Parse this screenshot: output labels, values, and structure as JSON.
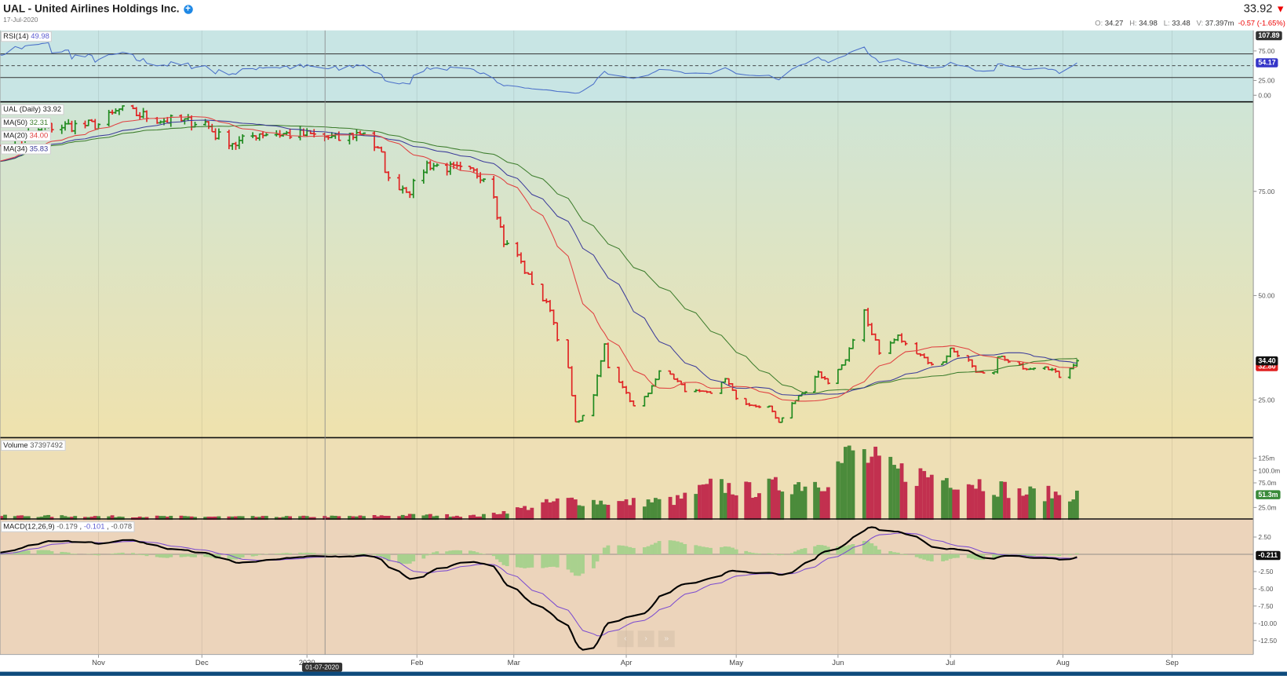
{
  "header": {
    "title": "UAL - United Airlines Holdings Inc.",
    "date": "17-Jul-2020",
    "last_price": "33.92",
    "arrow": "▼",
    "o_label": "O:",
    "o": "34.27",
    "h_label": "H:",
    "h": "34.98",
    "l_label": "L:",
    "l": "33.48",
    "v_label": "V:",
    "v": "37.397m",
    "change": "-0.57 (-1.65%)"
  },
  "legends": {
    "rsi_label": "RSI(14)",
    "rsi_value": "49.98",
    "price_label": "UAL (Daily)",
    "price_value": "33.92",
    "ma50_label": "MA(50)",
    "ma50_value": "32.31",
    "ma20_label": "MA(20)",
    "ma20_value": "34.00",
    "ma34_label": "MA(34)",
    "ma34_value": "35.83",
    "volume_label": "Volume",
    "volume_value": "37397492",
    "macd_label": "MACD(12,26,9)",
    "macd_v1": "-0.179",
    "macd_sep": ",",
    "macd_v2": "-0.101",
    "macd_v3": "-0.078"
  },
  "markers": {
    "rsi_max": "107.89",
    "rsi_last": "54.17",
    "price_last": "34.40",
    "price_ma": "32.80",
    "volume_last": "51.3m",
    "macd_last": "-0.211"
  },
  "crosshair_date": "01-07-2020",
  "nav": {
    "prev": "‹",
    "next": "›",
    "end": "»"
  },
  "colors": {
    "up": "#1f8a1f",
    "down": "#e02424",
    "vol_up": "#4b8b3b",
    "vol_down": "#c2304f",
    "ma20": "#e04040",
    "ma34": "#3b3b9a",
    "ma50": "#3d7d2d",
    "rsi": "#4a6fc9",
    "macd": "#000000",
    "signal": "#7b4bd0",
    "hist": "#a9d18e",
    "tag_rsi": "#3535c8",
    "tag_vol": "#3a8a3a"
  },
  "x_axis": {
    "ticks": [
      "Nov",
      "Dec",
      "2020",
      "Feb",
      "Mar",
      "Apr",
      "May",
      "Jun",
      "Jul",
      "Aug",
      "Sep"
    ]
  },
  "chart_data": [
    {
      "type": "ohlc",
      "panel": "price",
      "yticks": [
        "75.00",
        "50.00",
        "25.00"
      ],
      "ytick_values": [
        75,
        50,
        25
      ],
      "closes": [
        [
          "2019-10-01",
          84.5
        ],
        [
          "2019-10-16",
          90.4
        ],
        [
          "2019-11-01",
          91
        ],
        [
          "2019-11-07",
          94.5
        ],
        [
          "2019-11-20",
          92
        ],
        [
          "2019-12-02",
          91.5
        ],
        [
          "2019-12-05",
          88.5
        ],
        [
          "2019-12-11",
          86.4
        ],
        [
          "2019-12-18",
          89
        ],
        [
          "2020-01-02",
          88.5
        ],
        [
          "2020-01-10",
          87.5
        ],
        [
          "2020-01-17",
          89.4
        ],
        [
          "2020-01-22",
          83.5
        ],
        [
          "2020-01-24",
          77.5
        ],
        [
          "2020-01-30",
          75.2
        ],
        [
          "2020-02-04",
          81.5
        ],
        [
          "2020-02-11",
          80.5
        ],
        [
          "2020-02-18",
          79.5
        ],
        [
          "2020-02-21",
          78.5
        ],
        [
          "2020-02-24",
          74.6
        ],
        [
          "2020-02-25",
          69.7
        ],
        [
          "2020-02-27",
          62.8
        ],
        [
          "2020-03-02",
          59.8
        ],
        [
          "2020-03-04",
          55.9
        ],
        [
          "2020-03-09",
          49
        ],
        [
          "2020-03-11",
          47
        ],
        [
          "2020-03-13",
          40
        ],
        [
          "2020-03-16",
          32.3
        ],
        [
          "2020-03-18",
          19.5
        ],
        [
          "2020-03-20",
          21
        ],
        [
          "2020-03-23",
          26.4
        ],
        [
          "2020-03-26",
          38.2
        ],
        [
          "2020-03-27",
          33
        ],
        [
          "2020-03-31",
          28.3
        ],
        [
          "2020-04-03",
          23.4
        ],
        [
          "2020-04-07",
          26.4
        ],
        [
          "2020-04-10",
          32.3
        ],
        [
          "2020-04-14",
          30.3
        ],
        [
          "2020-04-17",
          27.4
        ],
        [
          "2020-04-24",
          26.4
        ],
        [
          "2020-04-28",
          30.3
        ],
        [
          "2020-05-01",
          25.4
        ],
        [
          "2020-05-06",
          23.4
        ],
        [
          "2020-05-11",
          23.4
        ],
        [
          "2020-05-14",
          19.5
        ],
        [
          "2020-05-18",
          24.4
        ],
        [
          "2020-05-22",
          26.8
        ],
        [
          "2020-05-26",
          31.3
        ],
        [
          "2020-05-29",
          29.3
        ],
        [
          "2020-06-03",
          34.3
        ],
        [
          "2020-06-08",
          47
        ],
        [
          "2020-06-09",
          43.1
        ],
        [
          "2020-06-11",
          39.2
        ],
        [
          "2020-06-12",
          36.2
        ],
        [
          "2020-06-17",
          40.2
        ],
        [
          "2020-06-19",
          38.2
        ],
        [
          "2020-06-23",
          36
        ],
        [
          "2020-06-26",
          33.3
        ],
        [
          "2020-06-29",
          34.3
        ],
        [
          "2020-07-01",
          37.2
        ],
        [
          "2020-07-06",
          34.3
        ],
        [
          "2020-07-08",
          31.3
        ],
        [
          "2020-07-13",
          31.3
        ],
        [
          "2020-07-14",
          35.8
        ],
        [
          "2020-07-17",
          33.9
        ],
        [
          "2020-07-22",
          32.7
        ],
        [
          "2020-07-27",
          33.3
        ],
        [
          "2020-07-29",
          32.2
        ],
        [
          "2020-07-31",
          30.7
        ],
        [
          "2020-08-04",
          33.6
        ],
        [
          "2020-08-05",
          34.4
        ]
      ],
      "series": [
        {
          "name": "MA(50)",
          "period": 50
        },
        {
          "name": "MA(20)",
          "period": 20
        },
        {
          "name": "MA(34)",
          "period": 34
        }
      ]
    },
    {
      "type": "line",
      "panel": "rsi",
      "period": 14,
      "yticks": [
        "75.00",
        "25.00",
        "0.00"
      ],
      "ytick_values": [
        75,
        25,
        0
      ],
      "levels": [
        70,
        50,
        30
      ],
      "ylim": [
        0,
        107.89
      ]
    },
    {
      "type": "bar",
      "panel": "volume",
      "unit": "m",
      "yticks": [
        "125m",
        "100.0m",
        "75.0m",
        "25.0m"
      ],
      "ytick_values": [
        125,
        100,
        75,
        25
      ],
      "volumes": [
        [
          "2019-10-01",
          8
        ],
        [
          "2019-12-15",
          6
        ],
        [
          "2020-01-15",
          7
        ],
        [
          "2020-02-01",
          10
        ],
        [
          "2020-02-20",
          8
        ],
        [
          "2020-03-01",
          20
        ],
        [
          "2020-03-15",
          40
        ],
        [
          "2020-04-01",
          35
        ],
        [
          "2020-04-15",
          40
        ],
        [
          "2020-04-25",
          70
        ],
        [
          "2020-05-05",
          60
        ],
        [
          "2020-05-15",
          70
        ],
        [
          "2020-05-28",
          80
        ],
        [
          "2020-06-05",
          140
        ],
        [
          "2020-06-15",
          100
        ],
        [
          "2020-06-25",
          90
        ],
        [
          "2020-07-10",
          75
        ],
        [
          "2020-07-20",
          55
        ],
        [
          "2020-08-05",
          51.3
        ]
      ]
    },
    {
      "type": "line",
      "panel": "macd",
      "params": [
        12,
        26,
        9
      ],
      "yticks": [
        "2.50",
        "-2.50",
        "-5.00",
        "-7.50",
        "-10.00",
        "-12.50"
      ],
      "ytick_values": [
        2.5,
        -2.5,
        -5,
        -7.5,
        -10,
        -12.5
      ]
    }
  ]
}
